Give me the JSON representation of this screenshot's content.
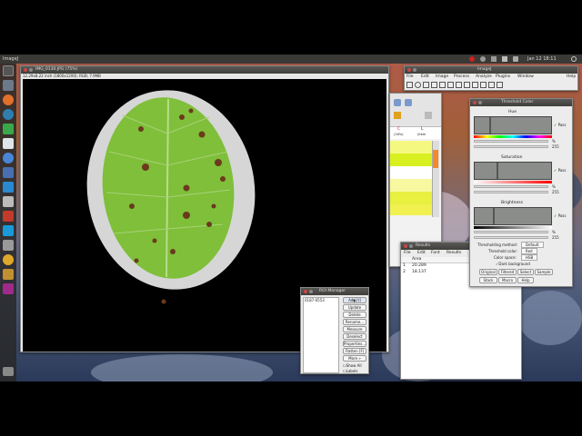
{
  "topbar": {
    "app_name": "ImageJ",
    "clock": "Jan 12 18:11"
  },
  "image_window": {
    "title": "IMG_0130.JPG (75%)",
    "info": "12.29x8.22 inch (1800x1200); RGB; 7.9MB"
  },
  "imagej_main": {
    "title": "ImageJ",
    "menu": [
      "File",
      "Edit",
      "Image",
      "Process",
      "Analyze",
      "Plugins",
      "Window",
      "Help"
    ]
  },
  "lut_window": {
    "headers": [
      "C",
      "L"
    ],
    "subheaders": [
      "(16%)",
      "(item"
    ]
  },
  "threshold": {
    "title": "Threshold Color",
    "hue_label": "Hue",
    "saturation_label": "Saturation",
    "brightness_label": "Brightness",
    "pass_label": "Pass",
    "slider_values": [
      "%",
      "255",
      "%",
      "255",
      "%",
      "255"
    ],
    "method_label": "Thresholding method:",
    "method_value": "Default",
    "color_label": "Threshold color:",
    "color_value": "Red",
    "space_label": "Color space:",
    "space_value": "HSB",
    "dark_bg_label": "Dark background",
    "buttons_row1": [
      "Original",
      "Filtered",
      "Select",
      "Sample"
    ],
    "buttons_row2": [
      "Stack",
      "Macro",
      "Help"
    ]
  },
  "results": {
    "title": "Results",
    "menu": [
      "File",
      "Edit",
      "Font",
      "Results"
    ],
    "column": "Area",
    "rows": [
      {
        "index": "1",
        "value": "20.289"
      },
      {
        "index": "2",
        "value": "18.137"
      }
    ]
  },
  "roi_manager": {
    "title": "ROI Manager",
    "list_item": "0187-0553",
    "buttons": [
      "Add [t]",
      "Update",
      "Delete",
      "Rename...",
      "Measure",
      "Deselect",
      "Properties...",
      "Flatten [F]",
      "More »"
    ],
    "show_all": "Show All",
    "labels": "Labels"
  },
  "colors": {
    "leaf": "#7fbf3a",
    "spot": "#6b3a1c",
    "hue_bar_left": "#ff0000"
  }
}
